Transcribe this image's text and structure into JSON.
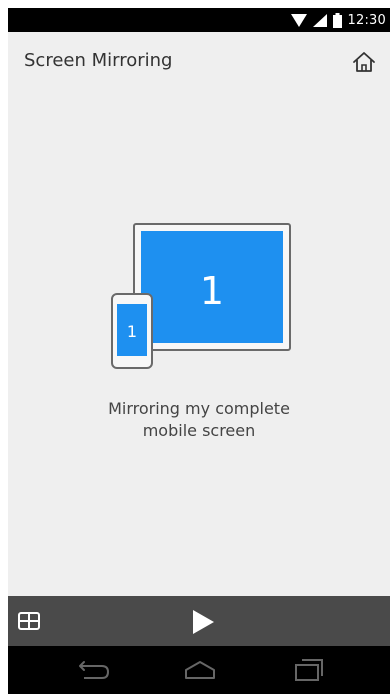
{
  "status_bar": {
    "time": "12:30",
    "icons": [
      "wifi-icon",
      "cell-signal-icon",
      "battery-icon"
    ]
  },
  "header": {
    "title": "Screen Mirroring",
    "home_icon": "home-icon"
  },
  "illustration": {
    "tablet_label": "1",
    "phone_label": "1",
    "accent_color": "#1e90f0"
  },
  "caption": {
    "line1": "Mirroring my complete",
    "line2": "mobile screen"
  },
  "action_bar": {
    "left_icon": "grid-icon",
    "center_icon": "play-icon"
  },
  "nav_bar": {
    "icons": [
      "back-icon",
      "home-icon",
      "recent-apps-icon"
    ]
  }
}
